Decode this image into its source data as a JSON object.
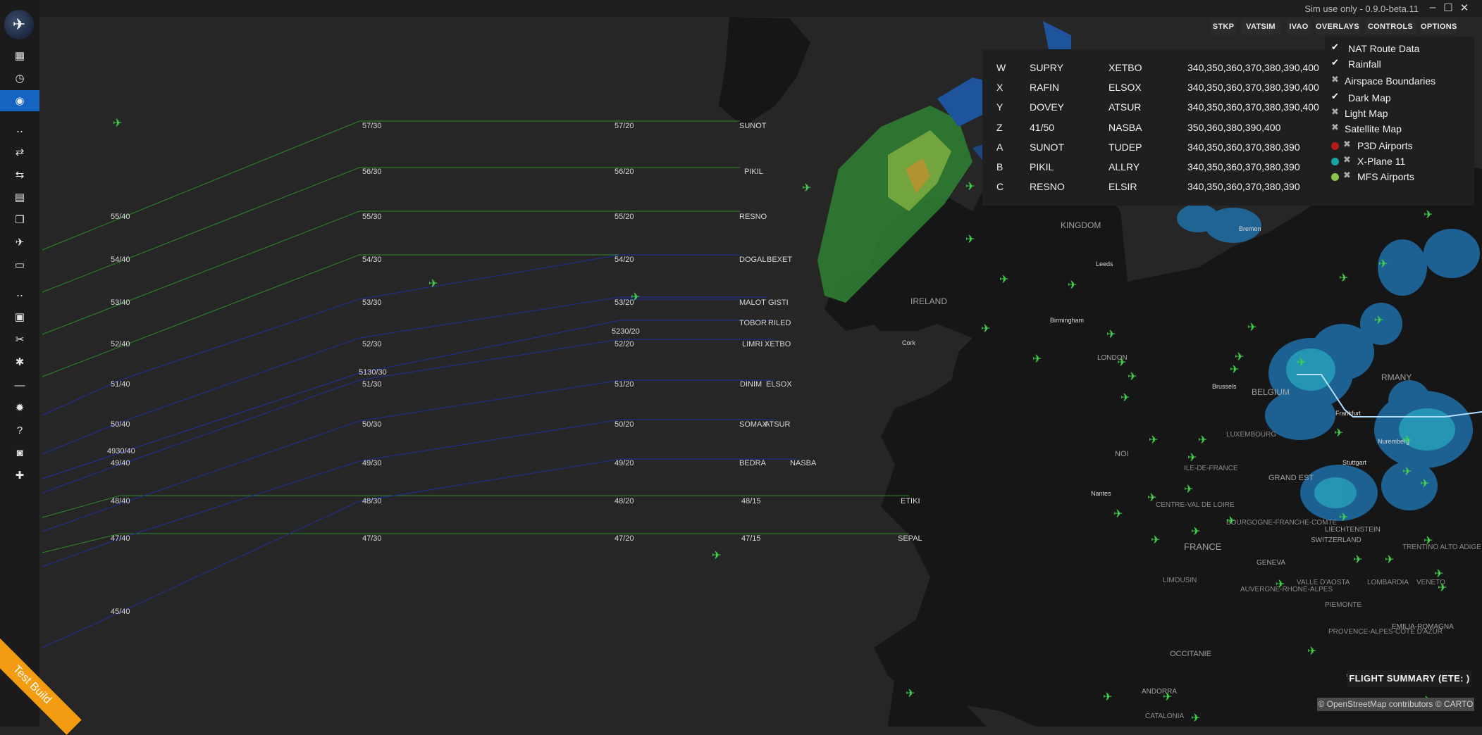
{
  "app": {
    "version_text": "Sim use only - 0.9.0-beta.11",
    "minimize": "–",
    "maximize": "☐",
    "close": "✕",
    "logo_icon": "✈"
  },
  "sidebar": {
    "items": [
      {
        "name": "dashboard-icon",
        "glyph": "▦"
      },
      {
        "name": "history-icon",
        "glyph": "◷"
      },
      {
        "name": "globe-icon",
        "glyph": "◉"
      },
      {
        "name": "separator-icon",
        "glyph": "‥"
      },
      {
        "name": "route-icon",
        "glyph": "⇄"
      },
      {
        "name": "route-alt-icon",
        "glyph": "⇆"
      },
      {
        "name": "calendar-icon",
        "glyph": "▤"
      },
      {
        "name": "documents-icon",
        "glyph": "❐"
      },
      {
        "name": "plane-icon",
        "glyph": "✈"
      },
      {
        "name": "file-icon",
        "glyph": "▭"
      },
      {
        "name": "separator2-icon",
        "glyph": "‥"
      },
      {
        "name": "suitcase-icon",
        "glyph": "▣"
      },
      {
        "name": "tools-icon",
        "glyph": "✂"
      },
      {
        "name": "settings-icon",
        "glyph": "✱"
      },
      {
        "name": "minus-icon",
        "glyph": "—"
      },
      {
        "name": "bug-icon",
        "glyph": "✹"
      },
      {
        "name": "help-icon",
        "glyph": "?"
      },
      {
        "name": "discord-icon",
        "glyph": "◙"
      },
      {
        "name": "gift-icon",
        "glyph": "✚"
      }
    ]
  },
  "topnav": [
    "STKP",
    "VATSIM",
    "IVAO",
    "OVERLAYS",
    "CONTROLS",
    "OPTIONS"
  ],
  "nat_table": [
    {
      "track": "W",
      "entry": "SUPRY",
      "exit": "XETBO",
      "levels": "340,350,360,370,380,390,400"
    },
    {
      "track": "X",
      "entry": "RAFIN",
      "exit": "ELSOX",
      "levels": "340,350,360,370,380,390,400"
    },
    {
      "track": "Y",
      "entry": "DOVEY",
      "exit": "ATSUR",
      "levels": "340,350,360,370,380,390,400"
    },
    {
      "track": "Z",
      "entry": "41/50",
      "exit": "NASBA",
      "levels": "350,360,380,390,400"
    },
    {
      "track": "A",
      "entry": "SUNOT",
      "exit": "TUDEP",
      "levels": "340,350,360,370,380,390"
    },
    {
      "track": "B",
      "entry": "PIKIL",
      "exit": "ALLRY",
      "levels": "340,350,360,370,380,390"
    },
    {
      "track": "C",
      "entry": "RESNO",
      "exit": "ELSIR",
      "levels": "340,350,360,370,380,390"
    }
  ],
  "overlays": [
    {
      "label": "NAT Route Data",
      "state": "on",
      "dot": null
    },
    {
      "label": "Rainfall",
      "state": "on",
      "dot": null
    },
    {
      "label": "Airspace Boundaries",
      "state": "off",
      "dot": null
    },
    {
      "label": "Dark Map",
      "state": "on",
      "dot": null
    },
    {
      "label": "Light Map",
      "state": "off",
      "dot": null
    },
    {
      "label": "Satellite Map",
      "state": "off",
      "dot": null
    },
    {
      "label": "P3D Airports",
      "state": "off",
      "dot": "#b71c1c"
    },
    {
      "label": "X-Plane 11",
      "state": "off",
      "dot": "#1aa3a3"
    },
    {
      "label": "MFS Airports",
      "state": "off",
      "dot": "#8bc34a"
    }
  ],
  "flight_summary": "FLIGHT SUMMARY (ETE: )",
  "attribution": "© OpenStreetMap contributors © CARTO",
  "test_build": "Test Build",
  "map_labels": [
    "IRELAND",
    "KINGDOM",
    "BELGIUM",
    "LUXEMBOURG",
    "NOI",
    "ILE-DE-FRANCE",
    "CENTRE-VAL DE LOIRE",
    "FRANCE",
    "BOURGOGNE-FRANCHE-COMTE",
    "GRAND EST",
    "LIMOUSIN",
    "AUVERGNE-RHONE-ALPES",
    "OCCITANIE",
    "ANDORRA",
    "CATALONIA",
    "GENEVA",
    "SWITZERLAND",
    "LIECHTENSTEIN",
    "EMILIA-ROMAGNA",
    "PIEMONTE",
    "VALLE D'AOSTA",
    "LOMBARDIA",
    "TRENTINO ALTO ADIGE",
    "VENETO",
    "PROVENCE-ALPES-COTE D'AZUR",
    "RMANY",
    "LONDON",
    "Birmingham",
    "Leeds",
    "Cork",
    "Bremen",
    "Nantes",
    "Brussels",
    "Frankfurt",
    "Stuttgart",
    "Nuremberg"
  ],
  "nat_labels": [
    "57/30",
    "57/20",
    "SUNOT",
    "56/30",
    "56/20",
    "PIKIL",
    "55/40",
    "55/30",
    "55/20",
    "RESNO",
    "54/40",
    "54/30",
    "54/20",
    "DOGAL",
    "BEXET",
    "53/40",
    "53/30",
    "53/20",
    "MALOT",
    "GISTI",
    "TOBOR",
    "RILED",
    "5230/20",
    "52/40",
    "52/30",
    "52/20",
    "LIMRI",
    "XETBO",
    "5130/30",
    "51/40",
    "51/30",
    "51/20",
    "DINIM",
    "ELSOX",
    "50/40",
    "50/30",
    "50/20",
    "SOMAX",
    "ATSUR",
    "4930/40",
    "49/40",
    "49/30",
    "49/20",
    "BEDRA",
    "NASBA",
    "48/40",
    "48/30",
    "48/20",
    "48/15",
    "ETIKI",
    "47/40",
    "47/30",
    "47/20",
    "47/15",
    "SEPAL",
    "45/40"
  ]
}
